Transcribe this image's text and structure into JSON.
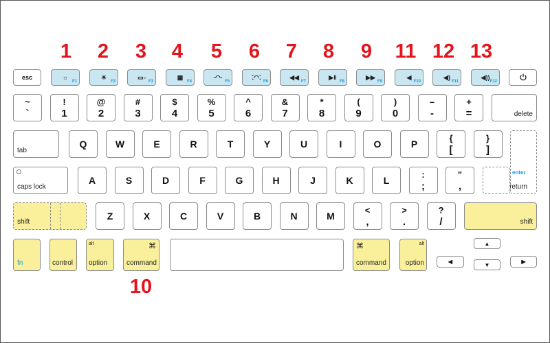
{
  "function_row": [
    {
      "label": "esc"
    },
    {
      "icon": "brightness-down-icon",
      "sub": "F1"
    },
    {
      "icon": "brightness-up-icon",
      "sub": "F2"
    },
    {
      "icon": "mission-control-icon",
      "sub": "F3"
    },
    {
      "icon": "launchpad-icon",
      "sub": "F4"
    },
    {
      "icon": "keyboard-light-down-icon",
      "sub": "F5"
    },
    {
      "icon": "keyboard-light-up-icon",
      "sub": "F6"
    },
    {
      "icon": "rewind-icon",
      "sub": "F7"
    },
    {
      "icon": "play-pause-icon",
      "sub": "F8"
    },
    {
      "icon": "fast-forward-icon",
      "sub": "F9"
    },
    {
      "icon": "mute-icon",
      "sub": "F10"
    },
    {
      "icon": "volume-down-icon",
      "sub": "F11"
    },
    {
      "icon": "volume-up-icon",
      "sub": "F12"
    },
    {
      "icon": "power-icon"
    }
  ],
  "number_row": [
    {
      "top": "~",
      "bottom": "`"
    },
    {
      "top": "!",
      "bottom": "1"
    },
    {
      "top": "@",
      "bottom": "2"
    },
    {
      "top": "#",
      "bottom": "3"
    },
    {
      "top": "$",
      "bottom": "4"
    },
    {
      "top": "%",
      "bottom": "5"
    },
    {
      "top": "^",
      "bottom": "6"
    },
    {
      "top": "&",
      "bottom": "7"
    },
    {
      "top": "*",
      "bottom": "8"
    },
    {
      "top": "(",
      "bottom": "9"
    },
    {
      "top": ")",
      "bottom": "0"
    },
    {
      "top": "–",
      "bottom": "-"
    },
    {
      "top": "+",
      "bottom": "="
    }
  ],
  "delete_label": "delete",
  "tab_label": "tab",
  "qwerty_row": [
    "Q",
    "W",
    "E",
    "R",
    "T",
    "Y",
    "U",
    "I",
    "O",
    "P"
  ],
  "bracket_keys": [
    {
      "top": "{",
      "bottom": "["
    },
    {
      "top": "}",
      "bottom": "]"
    }
  ],
  "caps_label": "caps lock",
  "home_row": [
    "A",
    "S",
    "D",
    "F",
    "G",
    "H",
    "J",
    "K",
    "L"
  ],
  "home_punct": [
    {
      "top": ":",
      "bottom": ";"
    },
    {
      "top": "\"",
      "bottom": ","
    }
  ],
  "enter_label": "enter",
  "return_label": "return",
  "shift_label": "shift",
  "bottom_letters": [
    "Z",
    "X",
    "C",
    "V",
    "B",
    "N",
    "M"
  ],
  "bottom_punct": [
    {
      "top": "<",
      "bottom": ","
    },
    {
      "top": ">",
      "bottom": "."
    },
    {
      "top": "?",
      "bottom": "/"
    }
  ],
  "modifiers": {
    "fn": "fn",
    "control": "control",
    "alt": "alt",
    "option": "option",
    "command": "command",
    "command_symbol": "⌘"
  },
  "arrows": {
    "up": "▲",
    "down": "▼",
    "left": "◀",
    "right": "▶"
  },
  "callouts": [
    "1",
    "2",
    "3",
    "4",
    "5",
    "6",
    "7",
    "8",
    "9",
    "11",
    "12",
    "13"
  ],
  "callout_command": "10",
  "colors": {
    "function_key": "#c9e6f1",
    "highlight": "#faf09c",
    "callout": "#e3141b",
    "fn_label": "#1a9ad6"
  }
}
